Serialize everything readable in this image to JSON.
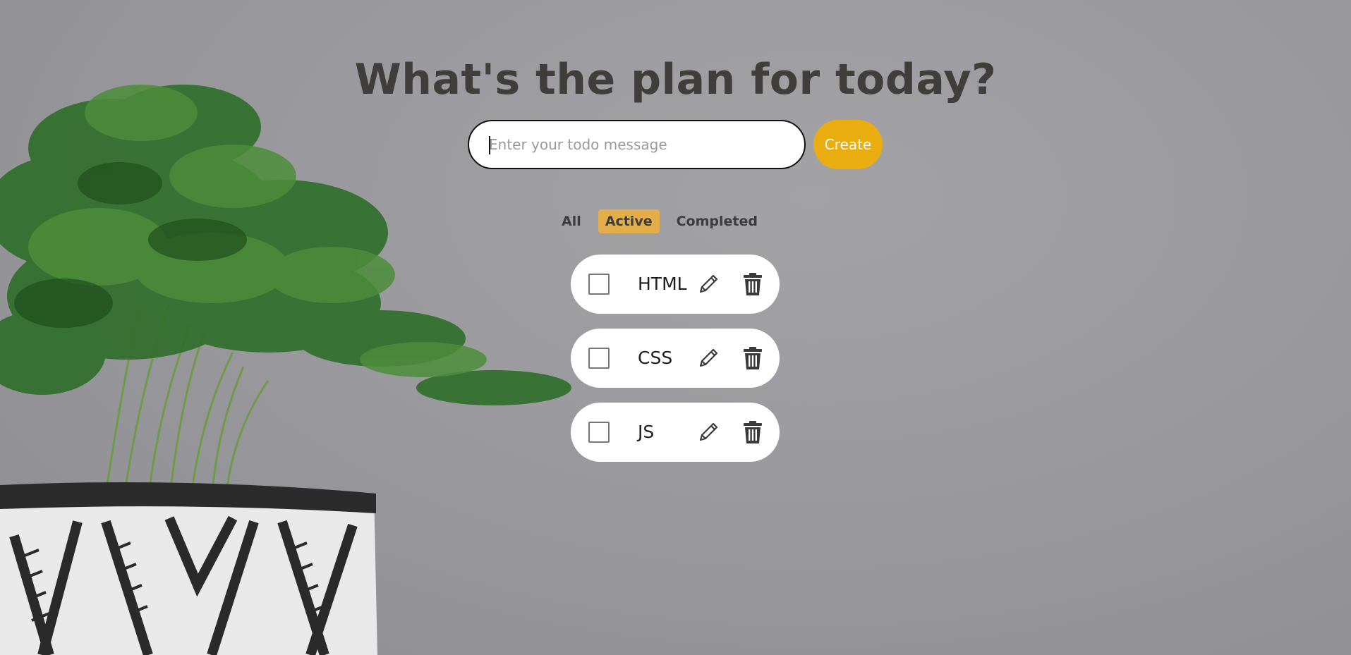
{
  "app": {
    "title": "What's the plan for today?"
  },
  "input": {
    "placeholder": "Enter your todo message",
    "value": ""
  },
  "create_button": {
    "label": "Create"
  },
  "filters": [
    {
      "label": "All",
      "active": false
    },
    {
      "label": "Active",
      "active": true
    },
    {
      "label": "Completed",
      "active": false
    }
  ],
  "todos": [
    {
      "text": "HTML",
      "completed": false
    },
    {
      "text": "CSS",
      "completed": false
    },
    {
      "text": "JS",
      "completed": false
    }
  ],
  "colors": {
    "accent": "#e9ad0f",
    "active_filter": "#e3ad49",
    "title": "#3f3e3b",
    "background": "#9a9a9e"
  },
  "icons": {
    "edit": "pencil-icon",
    "delete": "trash-icon"
  }
}
